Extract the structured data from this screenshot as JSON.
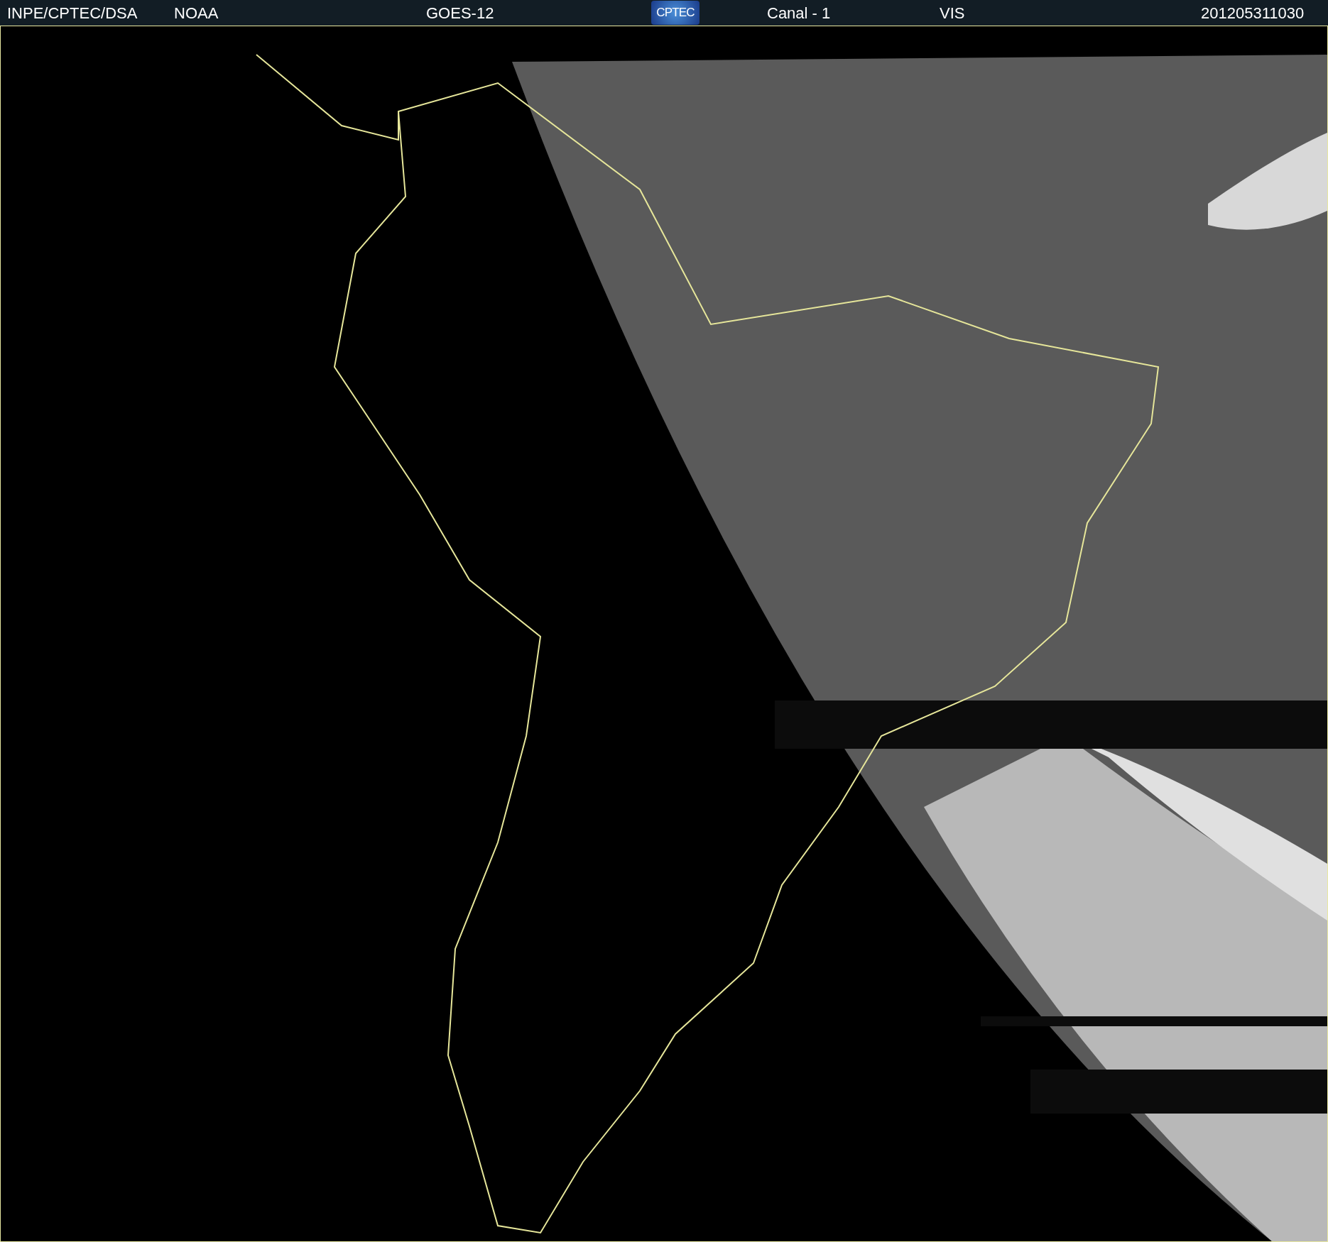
{
  "header": {
    "agency": "INPE/CPTEC/DSA",
    "source": "NOAA",
    "satellite": "GOES-12",
    "logo": "CPTEC",
    "channel": "Canal - 1",
    "band": "VIS",
    "timestamp": "201205311030"
  }
}
